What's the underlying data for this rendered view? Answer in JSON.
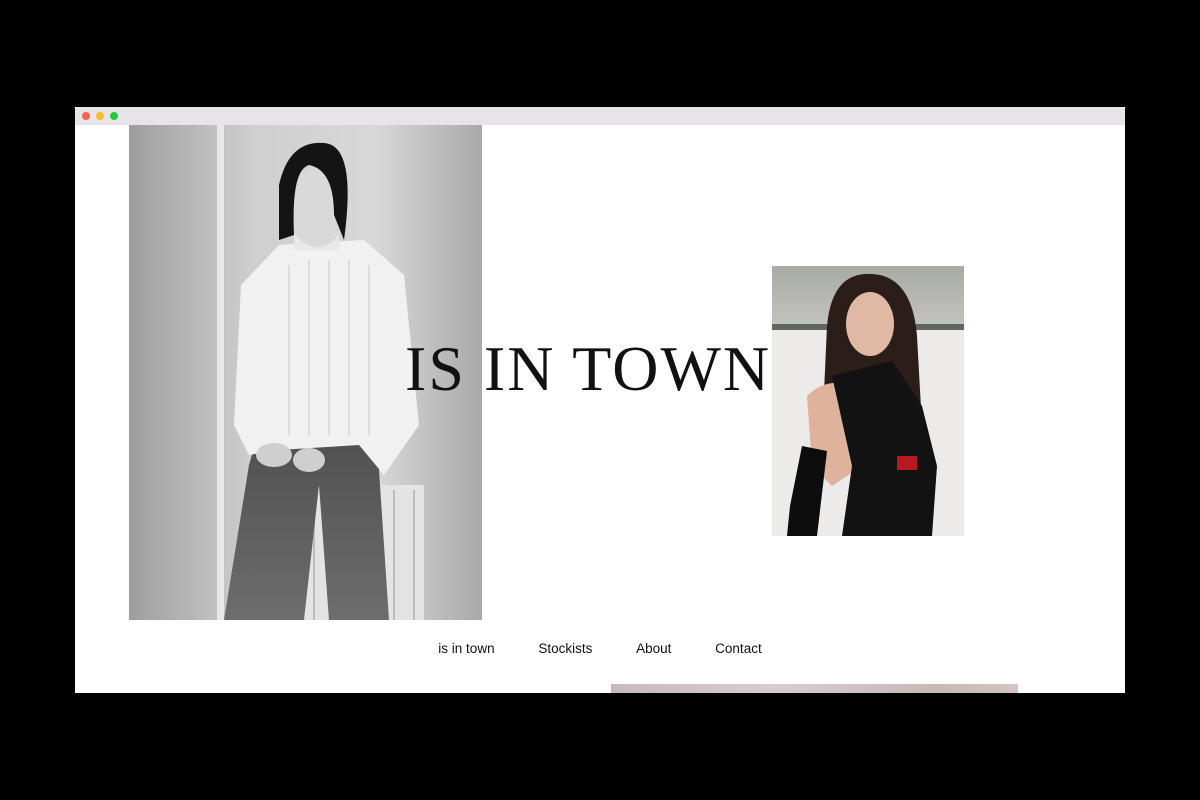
{
  "window": {
    "traffic_lights": [
      "close",
      "minimize",
      "maximize"
    ],
    "colors": {
      "close": "#fc5f57",
      "minimize": "#fdbb2e",
      "maximize": "#29c841"
    }
  },
  "hero": {
    "title": "IS IN TOWN",
    "left_image": {
      "description_icon": "model-bw-photo",
      "tone": "black-and-white"
    },
    "right_image": {
      "description_icon": "model-color-photo",
      "tone": "color"
    }
  },
  "nav": {
    "items": [
      {
        "label": "is in town"
      },
      {
        "label": "Stockists"
      },
      {
        "label": "About"
      },
      {
        "label": "Contact"
      }
    ]
  },
  "colors": {
    "background": "#ffffff",
    "frame": "#000000",
    "text": "#111111"
  }
}
